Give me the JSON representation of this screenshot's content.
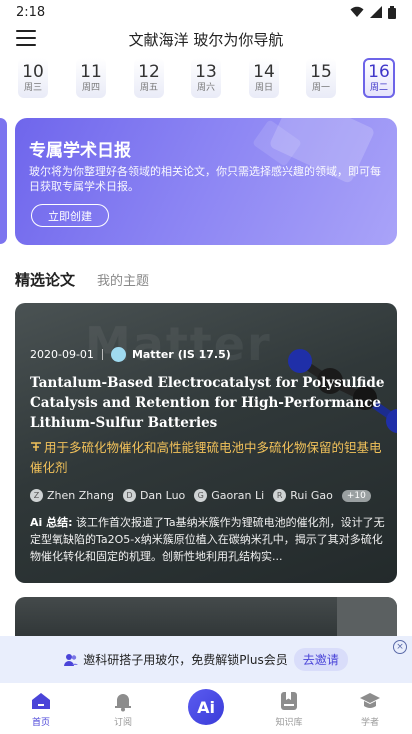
{
  "status_bar": {
    "time": "2:18"
  },
  "header": {
    "title": "文献海洋 玻尔为你导航"
  },
  "dates": [
    {
      "day": "10",
      "weekday": "周三"
    },
    {
      "day": "11",
      "weekday": "周四"
    },
    {
      "day": "12",
      "weekday": "周五"
    },
    {
      "day": "13",
      "weekday": "周六"
    },
    {
      "day": "14",
      "weekday": "周日"
    },
    {
      "day": "15",
      "weekday": "周一"
    },
    {
      "day": "16",
      "weekday": "周二",
      "selected": true
    }
  ],
  "banner": {
    "title": "专属学术日报",
    "description": "玻尔将为你整理好各领域的相关论文，你只需选择感兴趣的领域，即可每日获取专属学术日报。",
    "button": "立即创建"
  },
  "tabs": {
    "active": "精选论文",
    "other": "我的主题"
  },
  "watermark": "Matter",
  "paper": {
    "date": "2020-09-01",
    "journal": "Matter",
    "impact": "(IS 17.5)",
    "title": "Tantalum-Based Electrocatalyst for Polysulfide Catalysis and Retention for High-Performance Lithium-Sulfur Batteries",
    "title_cn": "用于多硫化物催化和高性能锂硫电池中多硫化物保留的钽基电催化剂",
    "authors": [
      {
        "initial": "Z",
        "name": "Zhen Zhang"
      },
      {
        "initial": "D",
        "name": "Dan Luo"
      },
      {
        "initial": "G",
        "name": "Gaoran Li"
      },
      {
        "initial": "R",
        "name": "Rui Gao"
      }
    ],
    "more_authors": "+10",
    "summary_label": "Ai 总结:",
    "summary": "该工作首次报道了Ta基纳米簇作为锂硫电池的催化剂，设计了无定型氧缺陷的Ta2O5-x纳米簇原位植入在碳纳米孔中，揭示了其对多硫化物催化转化和固定的机理。创新性地利用孔结构实..."
  },
  "invite": {
    "text": "邀科研搭子用玻尔，免费解锁Plus会员",
    "button": "去邀请",
    "close": "×"
  },
  "nav": {
    "home": "首页",
    "subscribe": "订阅",
    "ai": "Ai",
    "library": "知识库",
    "scholar": "学者"
  },
  "colors": {
    "accent": "#4a44d8",
    "banner": "#7c74ef",
    "highlight": "#f1c15a"
  }
}
